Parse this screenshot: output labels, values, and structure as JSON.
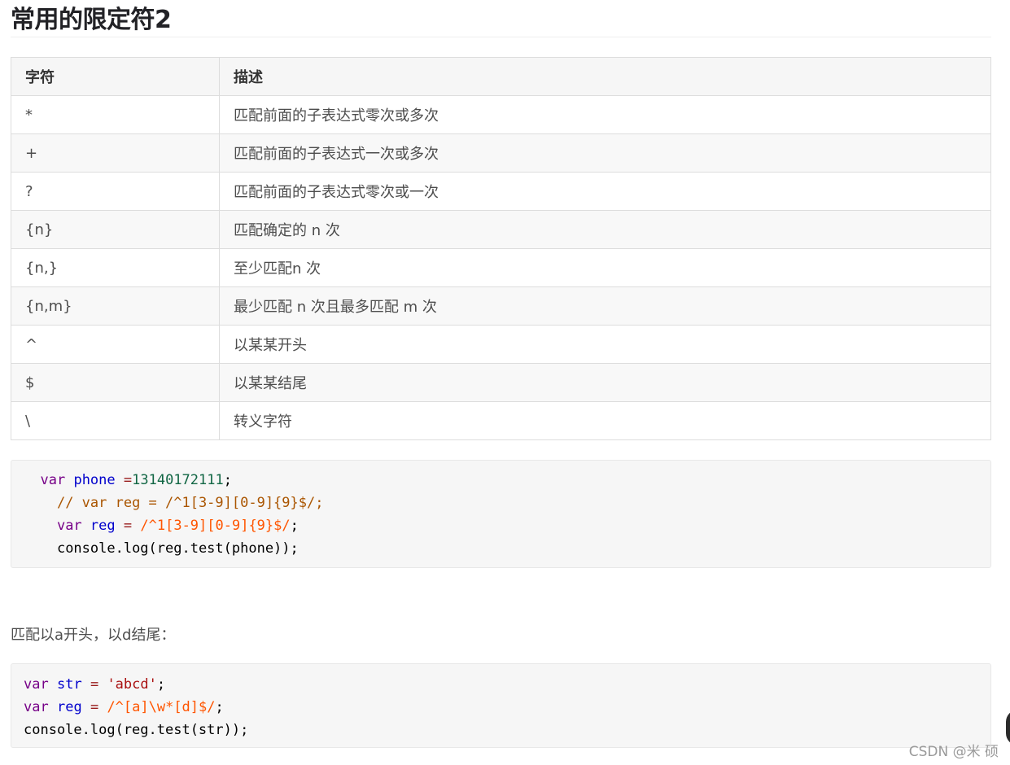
{
  "title": "常用的限定符2",
  "table": {
    "headers": [
      "字符",
      "描述"
    ],
    "rows": [
      [
        "*",
        "匹配前面的子表达式零次或多次"
      ],
      [
        "+",
        "匹配前面的子表达式一次或多次"
      ],
      [
        "?",
        "匹配前面的子表达式零次或一次"
      ],
      [
        "{n}",
        "匹配确定的 n 次"
      ],
      [
        "{n,}",
        "至少匹配n 次"
      ],
      [
        "{n,m}",
        "最少匹配 n 次且最多匹配 m 次"
      ],
      [
        "^",
        "以某某开头"
      ],
      [
        "$",
        "以某某结尾"
      ],
      [
        "\\",
        "转义字符"
      ]
    ]
  },
  "code_block_1": {
    "lines": [
      [
        {
          "t": "  ",
          "c": ""
        },
        {
          "t": "var",
          "c": "kw"
        },
        {
          "t": " ",
          "c": ""
        },
        {
          "t": "phone",
          "c": "def"
        },
        {
          "t": " ",
          "c": ""
        },
        {
          "t": "=",
          "c": "op"
        },
        {
          "t": "13140172111",
          "c": "num"
        },
        {
          "t": ";",
          "c": ""
        }
      ],
      [
        {
          "t": "    ",
          "c": ""
        },
        {
          "t": "// var reg = /^1[3-9][0-9]{9}$/;",
          "c": "cmt"
        }
      ],
      [
        {
          "t": "    ",
          "c": ""
        },
        {
          "t": "var",
          "c": "kw"
        },
        {
          "t": " ",
          "c": ""
        },
        {
          "t": "reg",
          "c": "def"
        },
        {
          "t": " ",
          "c": ""
        },
        {
          "t": "=",
          "c": "op"
        },
        {
          "t": " ",
          "c": ""
        },
        {
          "t": "/^1[3-9][0-9]{9}$/",
          "c": "re"
        },
        {
          "t": ";",
          "c": ""
        }
      ],
      [
        {
          "t": "    ",
          "c": ""
        },
        {
          "t": "console.log(reg.test(phone));",
          "c": ""
        }
      ]
    ]
  },
  "paragraph": "匹配以a开头，以d结尾：",
  "code_block_2": {
    "lines": [
      [
        {
          "t": "var",
          "c": "kw"
        },
        {
          "t": " ",
          "c": ""
        },
        {
          "t": "str",
          "c": "def"
        },
        {
          "t": " ",
          "c": ""
        },
        {
          "t": "=",
          "c": "op"
        },
        {
          "t": " ",
          "c": ""
        },
        {
          "t": "'abcd'",
          "c": "str"
        },
        {
          "t": ";",
          "c": ""
        }
      ],
      [
        {
          "t": "var",
          "c": "kw"
        },
        {
          "t": " ",
          "c": ""
        },
        {
          "t": "reg",
          "c": "def"
        },
        {
          "t": " ",
          "c": ""
        },
        {
          "t": "=",
          "c": "op"
        },
        {
          "t": " ",
          "c": ""
        },
        {
          "t": "/^[a]\\w*[d]$/",
          "c": "re"
        },
        {
          "t": ";",
          "c": ""
        }
      ],
      [
        {
          "t": "console.log(reg.test(str));",
          "c": ""
        }
      ]
    ]
  },
  "watermark": "CSDN @米 硕",
  "colors": {
    "keyword": "#770088",
    "variable": "#0000cc",
    "number": "#116644",
    "comment": "#aa5500",
    "regex": "#ff5500",
    "string": "#aa1111"
  }
}
